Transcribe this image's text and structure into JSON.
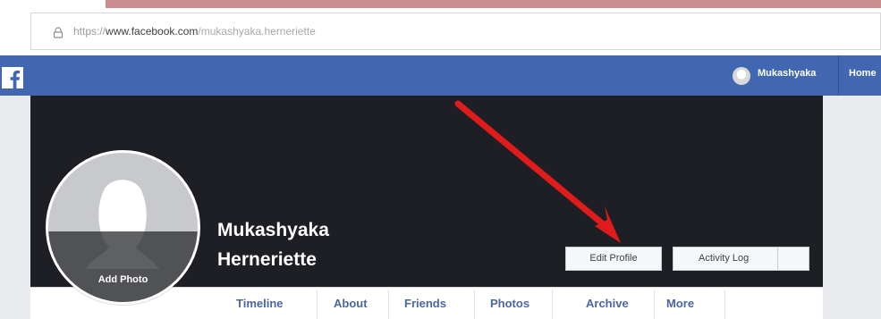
{
  "browser": {
    "url_protocol": "https://",
    "url_domain": "www.facebook.com",
    "url_path": "/mukashyaka.herneriette",
    "lock_icon": "lock-icon"
  },
  "topbar": {
    "logo_icon": "facebook-logo-icon",
    "user_name": "Mukashyaka",
    "home_label": "Home",
    "brand_color": "#4267b2"
  },
  "profile": {
    "add_photo_label": "Add Photo",
    "name_line_1": "Mukashyaka",
    "name_line_2": "Herneriette",
    "edit_profile_label": "Edit Profile",
    "activity_log_label": "Activity Log"
  },
  "tabs": [
    {
      "label": "Timeline"
    },
    {
      "label": "About"
    },
    {
      "label": "Friends"
    },
    {
      "label": "Photos"
    },
    {
      "label": "Archive"
    },
    {
      "label": "More"
    }
  ],
  "annotation": {
    "arrow_color": "#e01b1b"
  }
}
